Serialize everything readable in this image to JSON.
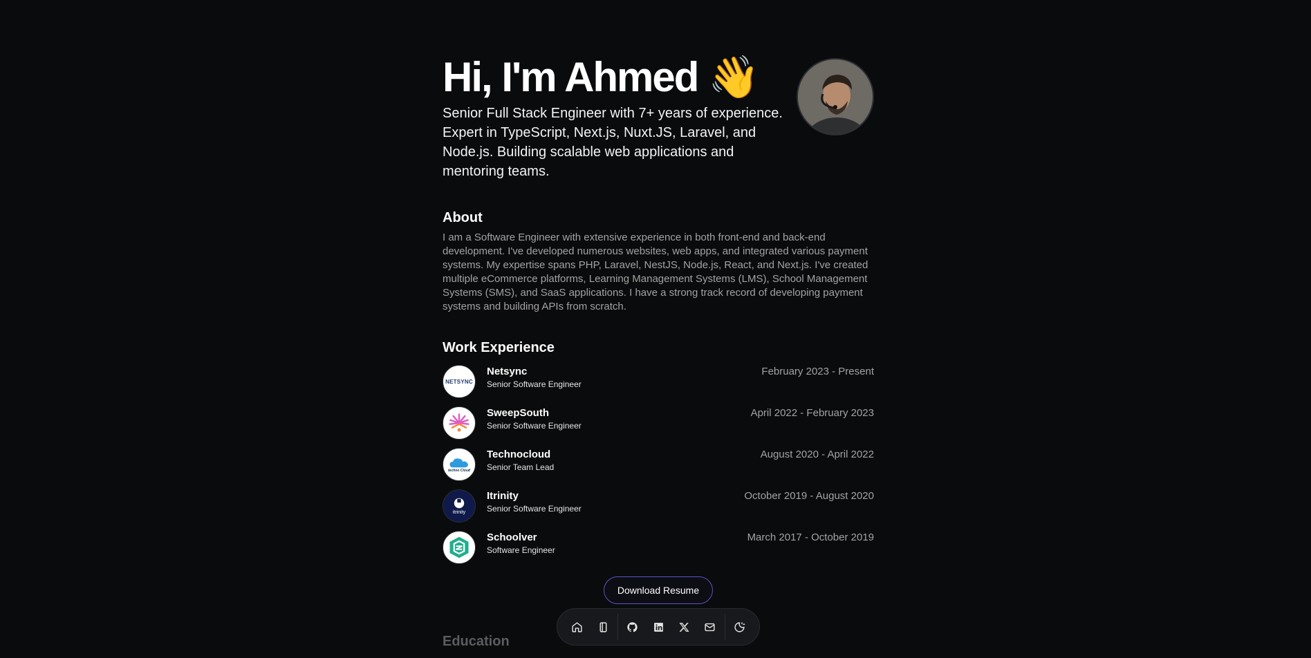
{
  "hero": {
    "title": "Hi, I'm Ahmed 👋",
    "subtitle": "Senior Full Stack Engineer with 7+ years of experience. Expert in TypeScript, Next.js, Nuxt.JS, Laravel, and Node.js. Building scalable web applications and mentoring teams."
  },
  "about": {
    "title": "About",
    "text": "I am a Software Engineer with extensive experience in both front-end and back-end development. I've developed numerous websites, web apps, and integrated various payment systems. My expertise spans PHP, Laravel, NestJS, Node.js, React, and Next.js. I've created multiple eCommerce platforms, Learning Management Systems (LMS), School Management Systems (SMS), and SaaS applications. I have a strong track record of developing payment systems and building APIs from scratch."
  },
  "work": {
    "title": "Work Experience",
    "jobs": [
      {
        "company": "Netsync",
        "role": "Senior Software Engineer",
        "dates": "February 2023 - Present",
        "logo_text": "NETSYNC"
      },
      {
        "company": "SweepSouth",
        "role": "Senior Software Engineer",
        "dates": "April 2022 - February 2023"
      },
      {
        "company": "Technocloud",
        "role": "Senior Team Lead",
        "dates": "August 2020 - April 2022",
        "logo_text": "techno Cloud"
      },
      {
        "company": "Itrinity",
        "role": "Senior Software Engineer",
        "dates": "October 2019 - August 2020",
        "logo_text": "itrinity"
      },
      {
        "company": "Schoolver",
        "role": "Software Engineer",
        "dates": "March 2017 - October 2019"
      }
    ]
  },
  "resume_button": "Download Resume",
  "education": {
    "title": "Education"
  },
  "dock": {
    "items": [
      "home-icon",
      "notebook-icon",
      "github-icon",
      "linkedin-icon",
      "x-icon",
      "mail-icon",
      "theme-toggle-icon"
    ]
  },
  "colors": {
    "background": "#0a0b0d",
    "muted_text": "#a3a3a3",
    "button_border": "#5b55c8"
  }
}
